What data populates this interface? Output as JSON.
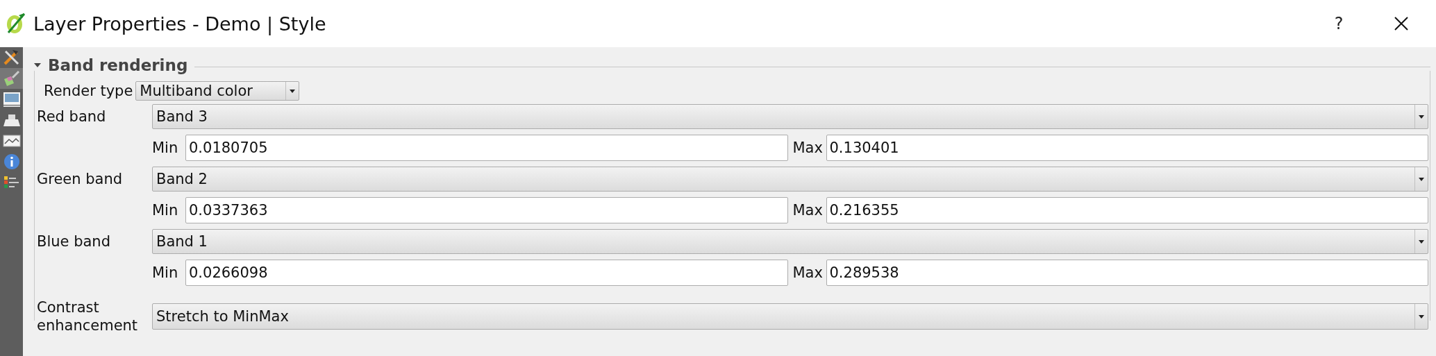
{
  "window": {
    "title": "Layer Properties - Demo | Style",
    "help": "?"
  },
  "sidebar": {
    "items": [
      {
        "kind": "tools",
        "selected": false
      },
      {
        "kind": "style",
        "selected": true
      },
      {
        "kind": "transparency",
        "selected": false
      },
      {
        "kind": "pyramids",
        "selected": false
      },
      {
        "kind": "histogram",
        "selected": false
      },
      {
        "kind": "info",
        "selected": false
      },
      {
        "kind": "legend",
        "selected": false
      }
    ]
  },
  "section": {
    "title": "Band rendering",
    "expanded": true,
    "render_type": {
      "label": "Render type",
      "value": "Multiband color"
    },
    "bands": [
      {
        "label": "Red band",
        "value": "Band 3",
        "min_label": "Min",
        "min": "0.0180705",
        "max_label": "Max",
        "max": "0.130401"
      },
      {
        "label": "Green band",
        "value": "Band 2",
        "min_label": "Min",
        "min": "0.0337363",
        "max_label": "Max",
        "max": "0.216355"
      },
      {
        "label": "Blue band",
        "value": "Band 1",
        "min_label": "Min",
        "min": "0.0266098",
        "max_label": "Max",
        "max": "0.289538"
      }
    ],
    "contrast": {
      "label": "Contrast enhancement",
      "value": "Stretch to MinMax"
    }
  }
}
